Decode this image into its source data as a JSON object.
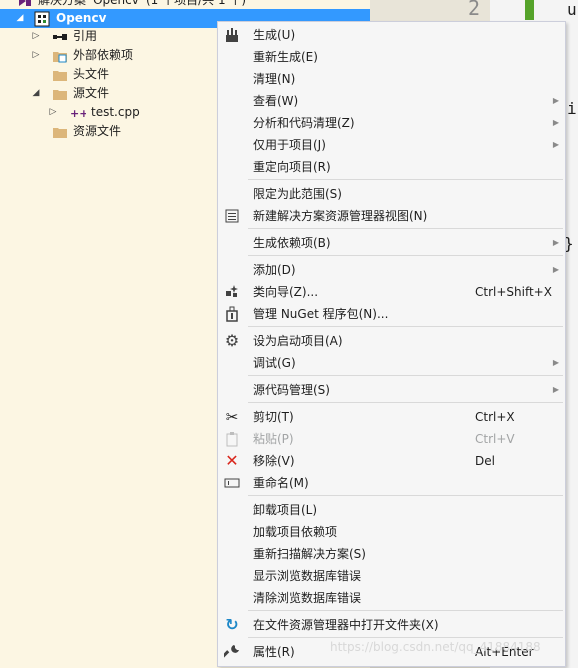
{
  "explorer": {
    "solution_label": "解决方案 'Opencv' (1 个项目/共 1 个)",
    "project_label": "Opencv",
    "items": [
      {
        "label": "引用"
      },
      {
        "label": "外部依赖项"
      },
      {
        "label": "头文件"
      },
      {
        "label": "源文件"
      },
      {
        "label": "test.cpp"
      },
      {
        "label": "资源文件"
      }
    ]
  },
  "editor": {
    "line_number": "2",
    "code_fragment_1": "u",
    "code_fragment_2": "i",
    "code_fragment_3": "}"
  },
  "menu": {
    "items": [
      {
        "label": "生成(U)",
        "icon": "build-icon"
      },
      {
        "label": "重新生成(E)"
      },
      {
        "label": "清理(N)"
      },
      {
        "label": "查看(W)",
        "submenu": true
      },
      {
        "label": "分析和代码清理(Z)",
        "submenu": true
      },
      {
        "label": "仅用于项目(J)",
        "submenu": true
      },
      {
        "label": "重定向项目(R)"
      },
      {
        "label": "限定为此范围(S)"
      },
      {
        "label": "新建解决方案资源管理器视图(N)",
        "icon": "new-view-icon"
      },
      {
        "label": "生成依赖项(B)",
        "submenu": true
      },
      {
        "label": "添加(D)",
        "submenu": true
      },
      {
        "label": "类向导(Z)...",
        "shortcut": "Ctrl+Shift+X",
        "icon": "class-wizard-icon"
      },
      {
        "label": "管理 NuGet 程序包(N)...",
        "icon": "nuget-icon"
      },
      {
        "label": "设为启动项目(A)",
        "icon": "gear-icon"
      },
      {
        "label": "调试(G)",
        "submenu": true
      },
      {
        "label": "源代码管理(S)",
        "submenu": true
      },
      {
        "label": "剪切(T)",
        "shortcut": "Ctrl+X",
        "icon": "scissors-icon"
      },
      {
        "label": "粘贴(P)",
        "shortcut": "Ctrl+V",
        "icon": "paste-icon",
        "disabled": true
      },
      {
        "label": "移除(V)",
        "shortcut": "Del",
        "icon": "remove-icon"
      },
      {
        "label": "重命名(M)",
        "icon": "rename-icon"
      },
      {
        "label": "卸载项目(L)"
      },
      {
        "label": "加载项目依赖项"
      },
      {
        "label": "重新扫描解决方案(S)"
      },
      {
        "label": "显示浏览数据库错误"
      },
      {
        "label": "清除浏览数据库错误"
      },
      {
        "label": "在文件资源管理器中打开文件夹(X)",
        "icon": "open-folder-icon"
      },
      {
        "label": "属性(R)",
        "shortcut": "Alt+Enter",
        "icon": "wrench-icon"
      }
    ]
  },
  "watermark": "https://blog.csdn.net/qq_41884188",
  "colors": {
    "selection": "#3399ff",
    "explorer_bg": "#fcf6e3",
    "menu_bg": "#f6f6f6",
    "remove_icon": "#d9261c",
    "refresh_icon": "#1e88c8"
  }
}
